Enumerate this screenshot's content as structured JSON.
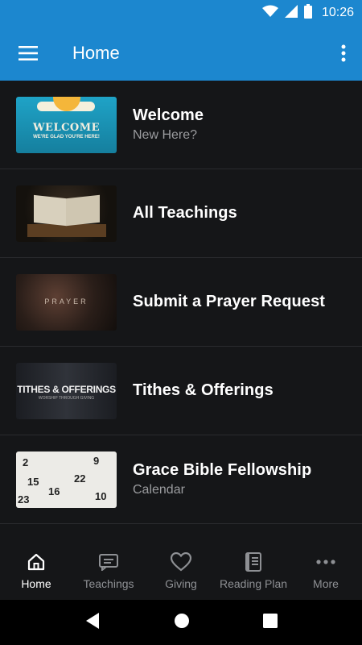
{
  "status": {
    "time": "10:26"
  },
  "appbar": {
    "title": "Home"
  },
  "items": [
    {
      "title": "Welcome",
      "subtitle": "New Here?",
      "thumb_text": "WELCOME",
      "thumb_subtext": "WE'RE GLAD YOU'RE HERE!"
    },
    {
      "title": "All Teachings",
      "subtitle": ""
    },
    {
      "title": "Submit a Prayer Request",
      "subtitle": "",
      "thumb_text": "PRAYER"
    },
    {
      "title": "Tithes & Offerings",
      "subtitle": "",
      "thumb_text": "TITHES & OFFERINGS",
      "thumb_subtext": "WORSHIP THROUGH GIVING"
    },
    {
      "title": "Grace Bible Fellowship",
      "subtitle": "Calendar",
      "thumb_numbers": [
        "2",
        "9",
        "15",
        "16",
        "22",
        "23",
        "10"
      ]
    }
  ],
  "bottom_nav": [
    {
      "label": "Home",
      "icon": "home-icon",
      "active": true
    },
    {
      "label": "Teachings",
      "icon": "message-icon"
    },
    {
      "label": "Giving",
      "icon": "heart-icon"
    },
    {
      "label": "Reading Plan",
      "icon": "book-icon"
    },
    {
      "label": "More",
      "icon": "more-horizontal-icon"
    }
  ],
  "colors": {
    "accent": "#1c87cf",
    "background": "#151618",
    "subtitle": "#9b9c9f",
    "nav_inactive": "#8e9094"
  }
}
